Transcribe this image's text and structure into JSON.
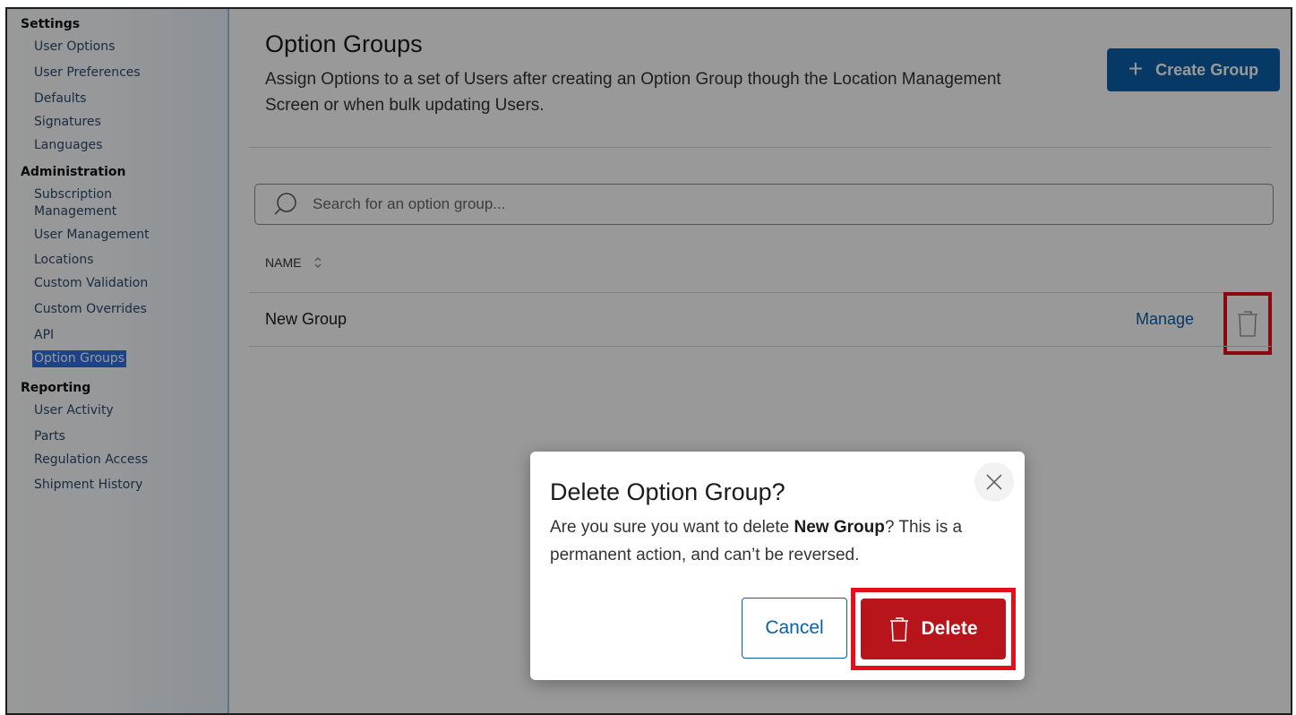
{
  "sidebar": {
    "sections": [
      {
        "heading": "Settings",
        "items": [
          "User Options",
          "User Preferences",
          "Defaults",
          "Signatures",
          "Languages"
        ]
      },
      {
        "heading": "Administration",
        "items": [
          "Subscription",
          "Management",
          "User Management",
          "Locations",
          "Custom Validation",
          "Custom Overrides",
          "API",
          "Option Groups"
        ]
      },
      {
        "heading": "Reporting",
        "items": [
          "User Activity",
          "Parts",
          "Regulation Access",
          "Shipment History"
        ]
      }
    ],
    "active_item": "Option Groups"
  },
  "header": {
    "title": "Option Groups",
    "description": "Assign Options to a set of Users after creating an Option Group though the Location Management Screen or when bulk updating Users.",
    "create_button": "Create Group"
  },
  "search": {
    "placeholder": "Search for an option group..."
  },
  "table": {
    "column_header": "NAME",
    "rows": [
      {
        "name": "New Group",
        "action": "Manage"
      }
    ]
  },
  "modal": {
    "title": "Delete Option Group?",
    "body_prefix": "Are you sure you want to delete ",
    "body_target": "New Group",
    "body_suffix": "? This is a permanent action, and can’t be reversed.",
    "cancel_label": "Cancel",
    "delete_label": "Delete"
  },
  "colors": {
    "primary": "#0a5fa8",
    "danger": "#b8141c",
    "highlight": "#e3101c",
    "active_nav": "#2f6fe6"
  },
  "icons": [
    "search-icon",
    "plus-icon",
    "sort-icon",
    "trash-icon",
    "close-icon"
  ]
}
